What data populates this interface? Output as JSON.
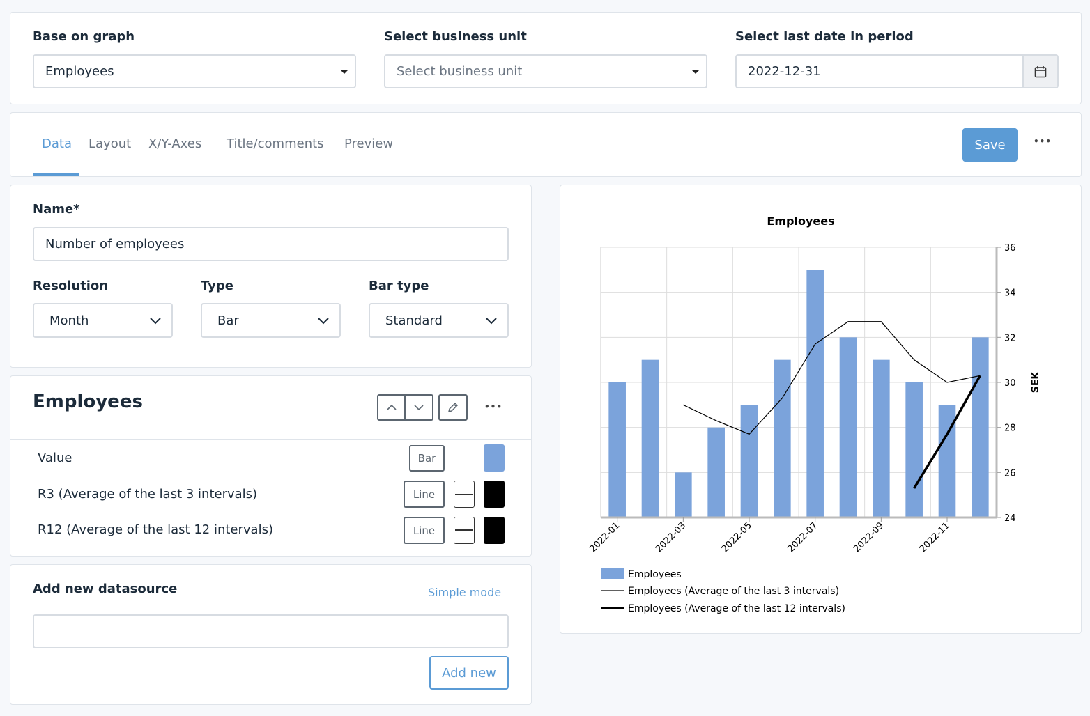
{
  "filters": {
    "graph_label": "Base on graph",
    "graph_value": "Employees",
    "bu_label": "Select business unit",
    "bu_placeholder": "Select business unit",
    "date_label": "Select last date in period",
    "date_value": "2022-12-31"
  },
  "tabs": [
    {
      "label": "Data",
      "active": true
    },
    {
      "label": "Layout"
    },
    {
      "label": "X/Y-Axes"
    },
    {
      "label": "Title/comments"
    },
    {
      "label": "Preview"
    }
  ],
  "toolbar": {
    "save_label": "Save",
    "more": "•••"
  },
  "form": {
    "name_label": "Name*",
    "name_value": "Number of employees",
    "resolution_label": "Resolution",
    "resolution_value": "Month",
    "type_label": "Type",
    "type_value": "Bar",
    "bartype_label": "Bar type",
    "bartype_value": "Standard"
  },
  "series_panel": {
    "title": "Employees",
    "more": "•••",
    "rows": [
      {
        "label": "Value",
        "style": "Bar",
        "color": "#7ba3db"
      },
      {
        "label": "R3 (Average of the last 3 intervals)",
        "style": "Line",
        "color": "#000000"
      },
      {
        "label": "R12 (Average of the last 12 intervals)",
        "style": "Line",
        "color": "#000000"
      }
    ]
  },
  "datasource": {
    "title": "Add new datasource",
    "simple_mode": "Simple mode",
    "input_value": "",
    "add_label": "Add new"
  },
  "colors": {
    "accent": "#5b9bd5",
    "bar": "#7ba3db"
  },
  "chart_data": {
    "type": "bar",
    "title": "Employees",
    "ylabel": "SEK",
    "ylim": [
      24,
      36
    ],
    "yticks": [
      24,
      26,
      28,
      30,
      32,
      34,
      36
    ],
    "categories": [
      "2022-01",
      "2022-02",
      "2022-03",
      "2022-04",
      "2022-05",
      "2022-06",
      "2022-07",
      "2022-08",
      "2022-09",
      "2022-10",
      "2022-11",
      "2022-12"
    ],
    "xtick_labels": [
      "2022-01",
      "2022-03",
      "2022-05",
      "2022-07",
      "2022-09",
      "2022-11"
    ],
    "series": [
      {
        "name": "Employees",
        "kind": "bar",
        "values": [
          30,
          31,
          26,
          28,
          29,
          31,
          35,
          32,
          31,
          30,
          29,
          32
        ]
      },
      {
        "name": "Employees (Average of the last 3 intervals)",
        "kind": "line",
        "values": [
          null,
          null,
          29,
          28.3,
          27.7,
          29.3,
          31.7,
          32.7,
          32.7,
          31,
          30,
          30.3
        ]
      },
      {
        "name": "Employees (Average of the last 12 intervals)",
        "kind": "line-thick",
        "values": [
          null,
          null,
          null,
          null,
          null,
          null,
          null,
          null,
          null,
          25.3,
          27.7,
          30.3
        ]
      }
    ],
    "legend": "bottom-left",
    "grid": true
  }
}
